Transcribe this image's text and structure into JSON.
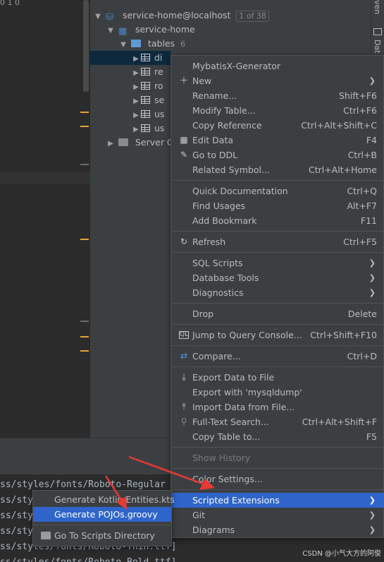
{
  "editor": {
    "top_info": "0  1  0"
  },
  "tree": {
    "datasource": {
      "label": "service-home@localhost",
      "badge": "1 of 38"
    },
    "schema": {
      "label": "service-home"
    },
    "tables": {
      "label": "tables",
      "count": "6"
    },
    "rows": [
      "di",
      "re",
      "ro",
      "se",
      "us",
      "us"
    ],
    "server": {
      "label": "Server C"
    }
  },
  "right_strip": {
    "top": "ven",
    "db": "Dat"
  },
  "menu": {
    "items": [
      {
        "label": "MybatisX-Generator",
        "shortcut": "",
        "icon": ""
      },
      {
        "label": "New",
        "shortcut": "",
        "icon": "plus-icon",
        "submenu": true
      },
      {
        "label": "Rename...",
        "shortcut": "Shift+F6"
      },
      {
        "label": "Modify Table...",
        "shortcut": "Ctrl+F6"
      },
      {
        "label": "Copy Reference",
        "shortcut": "Ctrl+Alt+Shift+C"
      },
      {
        "label": "Edit Data",
        "shortcut": "F4",
        "icon": "table-icon"
      },
      {
        "label": "Go to DDL",
        "shortcut": "Ctrl+B",
        "icon": "pencil-icon"
      },
      {
        "label": "Related Symbol...",
        "shortcut": "Ctrl+Alt+Home"
      },
      {
        "label": "Quick Documentation",
        "shortcut": "Ctrl+Q"
      },
      {
        "label": "Find Usages",
        "shortcut": "Alt+F7"
      },
      {
        "label": "Add Bookmark",
        "shortcut": "F11"
      },
      {
        "label": "Refresh",
        "shortcut": "Ctrl+F5",
        "icon": "refresh-icon"
      },
      {
        "label": "SQL Scripts",
        "shortcut": "",
        "submenu": true
      },
      {
        "label": "Database Tools",
        "shortcut": "",
        "submenu": true
      },
      {
        "label": "Diagnostics",
        "shortcut": "",
        "submenu": true
      },
      {
        "label": "Drop",
        "shortcut": "Delete"
      },
      {
        "label": "Jump to Query Console...",
        "shortcut": "Ctrl+Shift+F10",
        "icon": "console-icon"
      },
      {
        "label": "Compare...",
        "shortcut": "Ctrl+D",
        "icon": "compare-icon"
      },
      {
        "label": "Export Data to File",
        "shortcut": "",
        "icon": "export-icon"
      },
      {
        "label": "Export with 'mysqldump'",
        "shortcut": ""
      },
      {
        "label": "Import Data from File...",
        "shortcut": "",
        "icon": "import-icon"
      },
      {
        "label": "Full-Text Search...",
        "shortcut": "Ctrl+Alt+Shift+F",
        "icon": "search-icon"
      },
      {
        "label": "Copy Table to...",
        "shortcut": "F5"
      },
      {
        "label": "Show History",
        "shortcut": "",
        "disabled": true
      },
      {
        "label": "Color Settings...",
        "shortcut": ""
      },
      {
        "label": "Scripted Extensions",
        "shortcut": "",
        "submenu": true,
        "highlighted": true
      },
      {
        "label": "Git",
        "shortcut": "",
        "submenu": true
      },
      {
        "label": "Diagrams",
        "shortcut": "",
        "submenu": true
      }
    ]
  },
  "submenu": {
    "items": [
      {
        "label": "Generate Kotlin Entities.kts"
      },
      {
        "label": "Generate POJOs.groovy",
        "highlighted": true
      },
      {
        "label": "Go To Scripts Directory",
        "icon": "folder-icon"
      }
    ]
  },
  "console": {
    "lines": [
      "ss/styles/fonts/Roboto-Regular",
      "ss/styles/fonts/Roboto-",
      "ss/styles/fonts/Roboto-",
      "ss/styles/fonts/Roboto-",
      "ss/styles/fonts/Roboto-Thin.ttf]",
      "ss/styles/fonts/Roboto-Bold.ttf]"
    ]
  },
  "watermark": "CSDN @小气大方的阿俊",
  "colors": {
    "highlight": "#2f65ca",
    "menu_bg": "#3c3f41",
    "arrow": "#e53935"
  }
}
